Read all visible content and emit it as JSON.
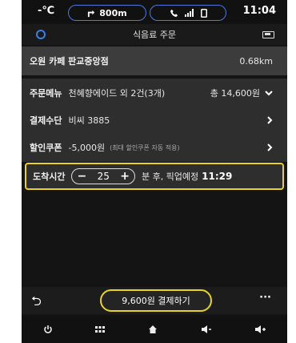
{
  "status": {
    "temperature": "-℃",
    "nav_distance": "800m",
    "clock": "11:04"
  },
  "title": "식음료 주문",
  "store": {
    "name": "오원 카페 판교중앙점",
    "distance": "0.68km"
  },
  "menu": {
    "label": "주문메뉴",
    "value": "천혜향에이드 외 2건(3개)",
    "total": "총 14,600원"
  },
  "payment": {
    "label": "결제수단",
    "value": "비씨 3885"
  },
  "coupon": {
    "label": "할인쿠폰",
    "value": "-5,000원",
    "note": "(최대 할인쿠폰 자동 적용)"
  },
  "arrival": {
    "label": "도착시간",
    "minutes": "25",
    "suffix": "분 후, 픽업예정",
    "pickup_time": "11:29"
  },
  "pay_button": "9,600원 결제하기",
  "icons": {
    "back": "back-arrow-icon",
    "more": "more-icon",
    "power": "power-icon",
    "apps": "apps-grid-icon",
    "home": "home-icon",
    "vol_down": "volume-down-icon",
    "vol_up": "volume-up-icon"
  },
  "colors": {
    "highlight": "#e8d22a",
    "accent": "#4a78d8"
  }
}
